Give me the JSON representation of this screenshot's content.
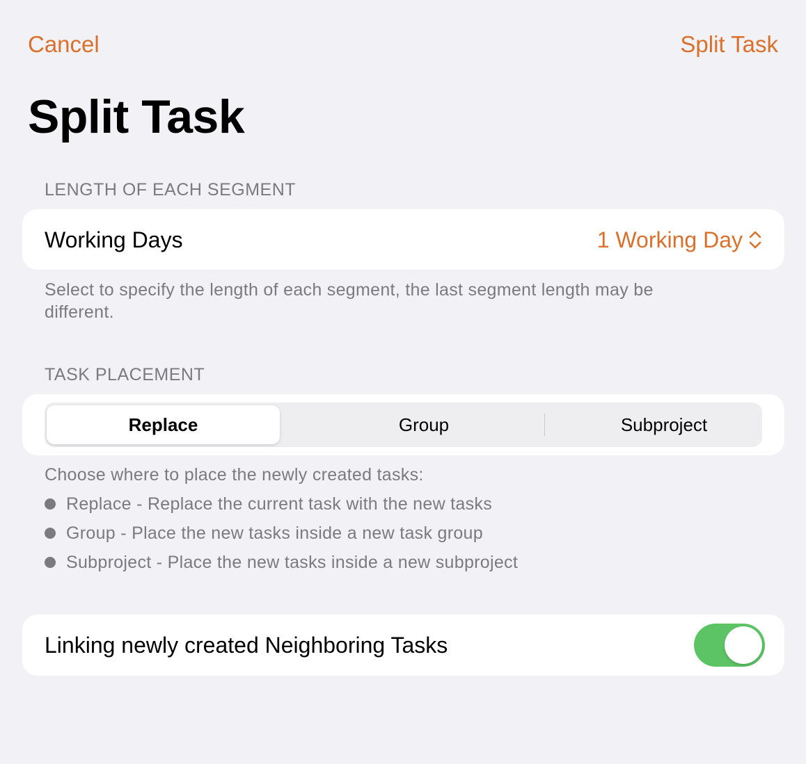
{
  "nav": {
    "cancel_label": "Cancel",
    "confirm_label": "Split Task"
  },
  "page_title": "Split Task",
  "segment_length": {
    "header": "LENGTH OF EACH SEGMENT",
    "row_label": "Working Days",
    "row_value": "1 Working Day",
    "value_icon": "chevron-up-down-icon",
    "footer": "Select to specify the length of each segment, the last segment length may be different."
  },
  "task_placement": {
    "header": "TASK PLACEMENT",
    "segments": [
      "Replace",
      "Group",
      "Subproject"
    ],
    "selected": "Replace",
    "footer_intro": "Choose where to place the newly created tasks:",
    "bullets": [
      "Replace - Replace the current task with the new tasks",
      "Group - Place the new tasks inside a new task group",
      "Subproject - Place the new tasks inside a new subproject"
    ]
  },
  "linking": {
    "label": "Linking newly created Neighboring Tasks",
    "enabled": true
  },
  "colors": {
    "accent": "#d9702c",
    "toggle_on": "#5dc465",
    "background": "#f2f1f6",
    "secondary_text": "#7a7a7f"
  }
}
